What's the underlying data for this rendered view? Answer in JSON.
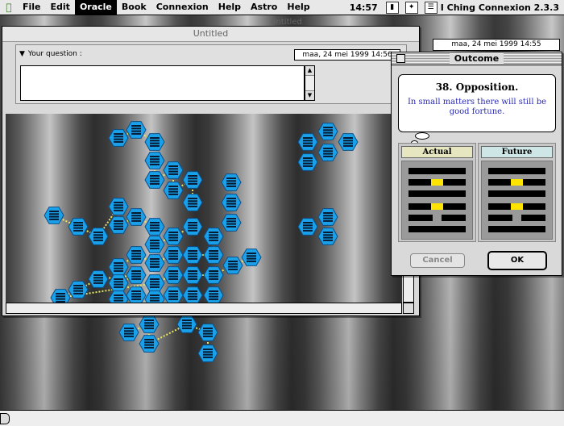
{
  "menubar": {
    "items": [
      "File",
      "Edit",
      "Oracle",
      "Book",
      "Connexion",
      "Help",
      "Astro",
      "Help"
    ],
    "active_index": 2,
    "clock": "14:57",
    "app_name": "I Ching Connexion 2.3.3"
  },
  "background_window": {
    "title": "Untitled",
    "date": "maa, 24 mei 1999   14:55"
  },
  "main_window": {
    "title": "Untitled",
    "question_label": "Your question :",
    "date": "maa, 24 mei 1999   14:56",
    "question_value": ""
  },
  "outcome": {
    "title": "Outcome",
    "hexagram_name": "38.  Opposition.",
    "hexagram_text": "In small matters there will still be good fortune.",
    "actual_label": "Actual",
    "future_label": "Future",
    "actual_lines": [
      "solid",
      "changing-broken",
      "solid",
      "changing-broken",
      "broken",
      "solid"
    ],
    "future_lines": [
      "solid",
      "changing-broken",
      "solid",
      "changing-broken",
      "broken",
      "solid"
    ],
    "cancel_label": "Cancel",
    "ok_label": "OK"
  },
  "colors": {
    "hex_blue": "#1aa0e8",
    "oracle_text": "#2a2ab8",
    "changing_line": "#ffe400"
  }
}
